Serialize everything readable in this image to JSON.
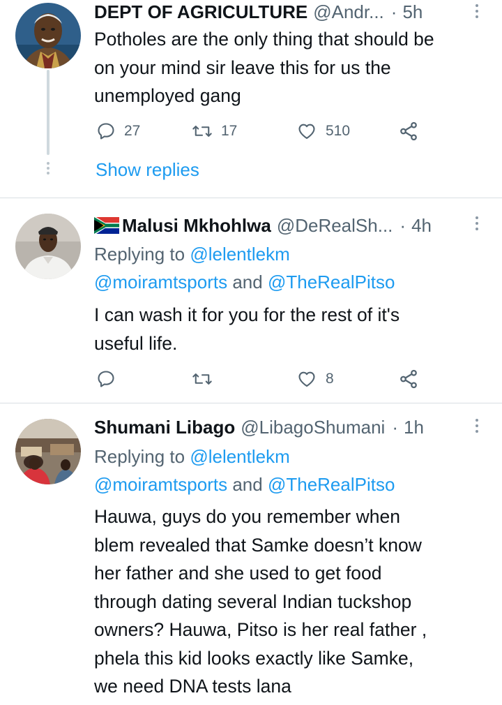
{
  "tweets": [
    {
      "author_name": "DEPT OF AGRICULTURE",
      "handle": "@Andr...",
      "separator": "·",
      "time": "5h",
      "body_lines": [
        "Potholes are the only thing that should be",
        "on your mind sir leave this for us the",
        "unemployed gang"
      ],
      "replies": "27",
      "retweets": "17",
      "likes": "510",
      "show_replies": "Show replies"
    },
    {
      "author_name": "Malusi Mkhohlwa",
      "flag": "south-africa-flag",
      "handle": "@DeRealSh...",
      "separator": "·",
      "time": "4h",
      "replying_prefix": "Replying to",
      "mention_1": "@lelentlekm",
      "mention_2": "@moiramtsports",
      "and_word": "and",
      "mention_3": "@TheRealPitso",
      "body_lines": [
        "I can wash  it for you for the rest of it's",
        "useful life."
      ],
      "replies": "",
      "retweets": "",
      "likes": "8"
    },
    {
      "author_name": "Shumani Libago",
      "handle": "@LibagoShumani",
      "separator": "·",
      "time": "1h",
      "replying_prefix": "Replying to",
      "mention_1": "@lelentlekm",
      "mention_2": "@moiramtsports",
      "and_word": "and",
      "mention_3": "@TheRealPitso",
      "body_lines": [
        "Hauwa, guys do you remember when",
        "blem revealed that Samke doesn’t know",
        "her father and she used to get food",
        "through dating several Indian tuckshop",
        "owners? Hauwa, Pitso is her real father ,",
        "phela this kid looks exactly like Samke,",
        "we need DNA tests lana"
      ]
    }
  ],
  "icons": {
    "reply": "reply-icon",
    "retweet": "retweet-icon",
    "like": "heart-icon",
    "share": "share-icon",
    "more": "more-vertical-icon"
  },
  "colors": {
    "link": "#1d9bf0",
    "secondary_text": "#536471",
    "primary_text": "#0f1419",
    "divider": "#d9dee2"
  }
}
